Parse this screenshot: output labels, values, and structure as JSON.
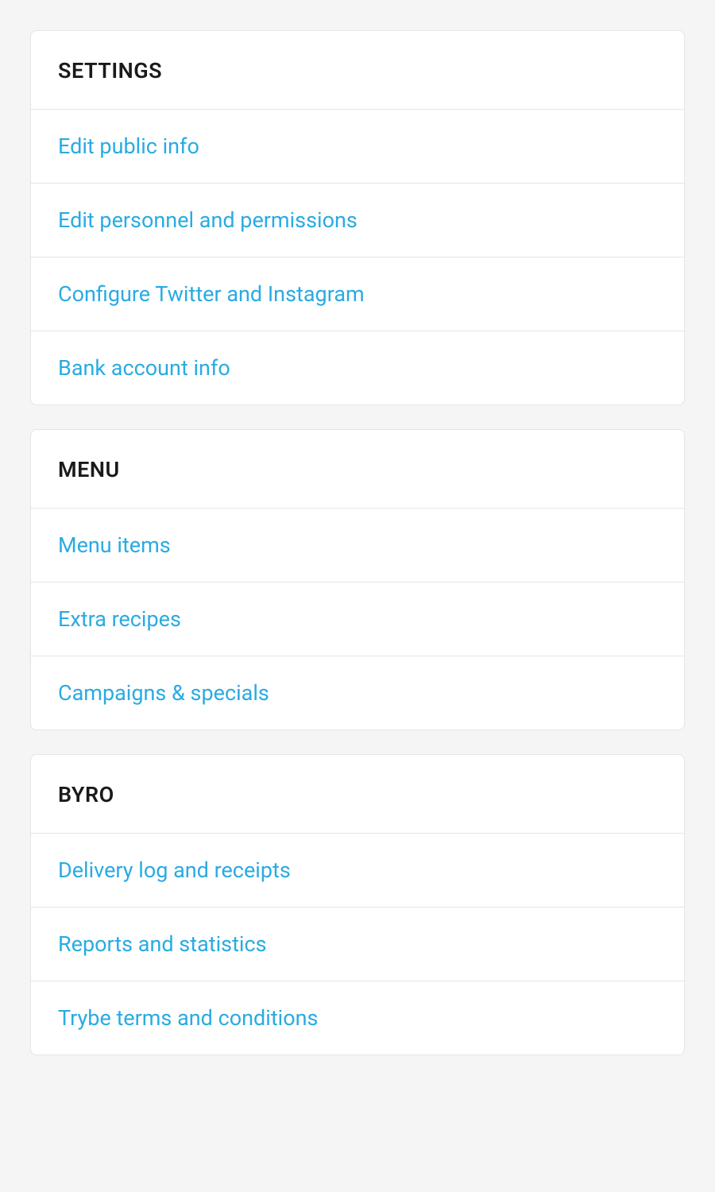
{
  "sections": [
    {
      "title": "SETTINGS",
      "items": [
        "Edit public info",
        "Edit personnel and permissions",
        "Configure Twitter and Instagram",
        "Bank account info"
      ]
    },
    {
      "title": "MENU",
      "items": [
        "Menu items",
        "Extra recipes",
        "Campaigns & specials"
      ]
    },
    {
      "title": "BYRO",
      "items": [
        "Delivery log and receipts",
        "Reports and statistics",
        "Trybe terms and conditions"
      ]
    }
  ]
}
